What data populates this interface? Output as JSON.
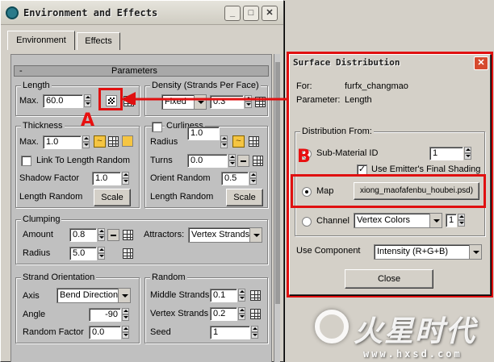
{
  "env_window": {
    "title": "Environment and Effects",
    "tabs": [
      "Environment",
      "Effects"
    ],
    "rollout_toggle": "-",
    "rollout_title": "Parameters",
    "length": {
      "group": "Length",
      "max_label": "Max.",
      "max_value": "60.0"
    },
    "density": {
      "group": "Density (Strands Per Face)",
      "mode_value": "Fixed",
      "value": "0.3"
    },
    "thickness": {
      "group": "Thickness",
      "max_label": "Max.",
      "max_value": "1.0",
      "link_label": "Link To Length Random",
      "shadow_label": "Shadow Factor",
      "shadow_value": "1.0",
      "length_random_label": "Length Random",
      "scale_label": "Scale"
    },
    "curliness": {
      "group": "Curliness",
      "radius_label": "Radius",
      "radius_value": "1.0",
      "turns_label": "Turns",
      "turns_value": "0.0",
      "orient_label": "Orient Random",
      "orient_value": "0.5",
      "length_random_label": "Length Random",
      "scale_label": "Scale"
    },
    "clumping": {
      "group": "Clumping",
      "amount_label": "Amount",
      "amount_value": "0.8",
      "radius_label": "Radius",
      "radius_value": "5.0",
      "attractors_label": "Attractors:",
      "attractors_value": "Vertex Strands"
    },
    "strand_orientation": {
      "group": "Strand Orientation",
      "axis_label": "Axis",
      "axis_value": "Bend Direction",
      "angle_label": "Angle",
      "angle_value": "-90",
      "random_factor_label": "Random Factor",
      "random_factor_value": "0.0"
    },
    "random": {
      "group": "Random",
      "middle_label": "Middle Strands",
      "middle_value": "0.1",
      "vertex_label": "Vertex Strands",
      "vertex_value": "0.2",
      "seed_label": "Seed",
      "seed_value": "1"
    }
  },
  "surface_window": {
    "title": "Surface Distribution",
    "for_label": "For:",
    "for_value": "furfx_changmao",
    "parameter_label": "Parameter:",
    "parameter_value": "Length",
    "distribution_group": "Distribution From:",
    "submaterial_label": "Sub-Material ID",
    "submaterial_value": "1",
    "use_emitter_label": "Use Emitter's Final Shading",
    "map_label": "Map",
    "map_value": "xiong_maofafenbu_houbei.psd)",
    "channel_label": "Channel",
    "channel_value": "Vertex Colors",
    "channel_number": "1",
    "use_component_label": "Use Component",
    "use_component_value": "Intensity (R+G+B)",
    "close_label": "Close"
  },
  "annotations": {
    "a": "A",
    "b": "B"
  },
  "watermark": {
    "url": "www.hxsd.com",
    "brand": "火星时代"
  },
  "colors": {
    "annotation_red": "#e01010",
    "panel_gray": "#c0c0c0",
    "window_gray": "#d4d0c8"
  }
}
